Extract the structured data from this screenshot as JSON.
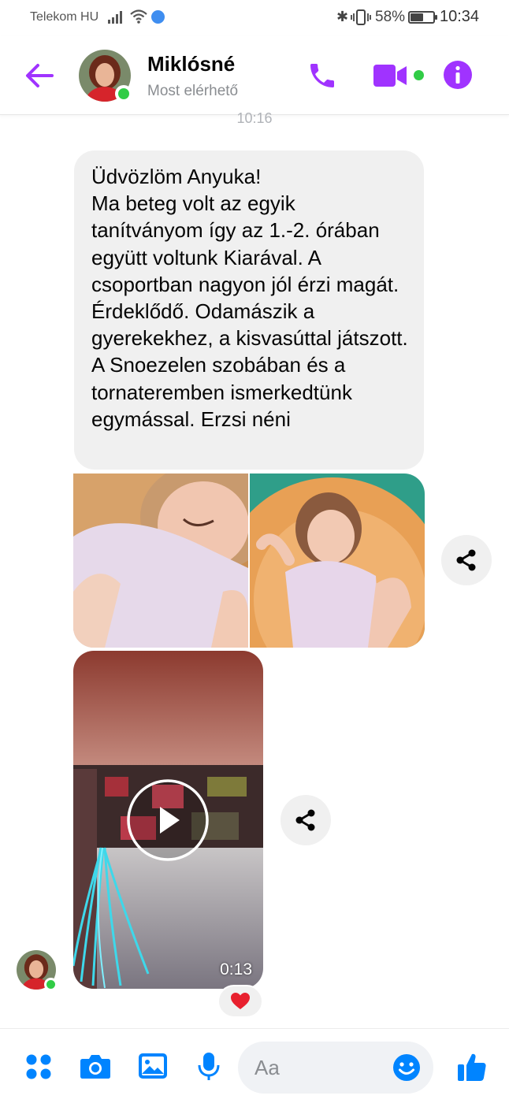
{
  "status_bar": {
    "carrier": "Telekom HU",
    "battery_percent": "58%",
    "battery_level": 0.58,
    "time": "10:34"
  },
  "header": {
    "contact_name": "Miklósné",
    "contact_status": "Most elérhető"
  },
  "conversation": {
    "timestamp": "10:16",
    "message_text": "Üdvözlöm Anyuka!\nMa beteg volt az egyik tanítványom így az 1.-2. órában együtt voltunk Kiarával. A csoportban nagyon jól érzi magát. Érdeklődő. Odamászik a gyerekekhez, a kisvasúttal játszott. A Snoezelen szobában és a tornateremben ismerkedtünk egymással. Erzsi néni",
    "video_duration": "0:13",
    "reaction": "❤️"
  },
  "composer": {
    "placeholder": "Aa"
  },
  "colors": {
    "accent": "#a033ff",
    "messenger_blue": "#0084ff",
    "online_green": "#31cc46",
    "bubble_gray": "#f0f0f0"
  },
  "icons": {
    "back": "arrow-left-icon",
    "call": "phone-icon",
    "video": "video-camera-icon",
    "info": "info-icon",
    "share": "share-icon",
    "play": "play-icon",
    "apps": "apps-grid-icon",
    "camera": "camera-icon",
    "gallery": "image-icon",
    "mic": "microphone-icon",
    "emoji": "smiley-icon",
    "like": "thumbs-up-icon"
  }
}
